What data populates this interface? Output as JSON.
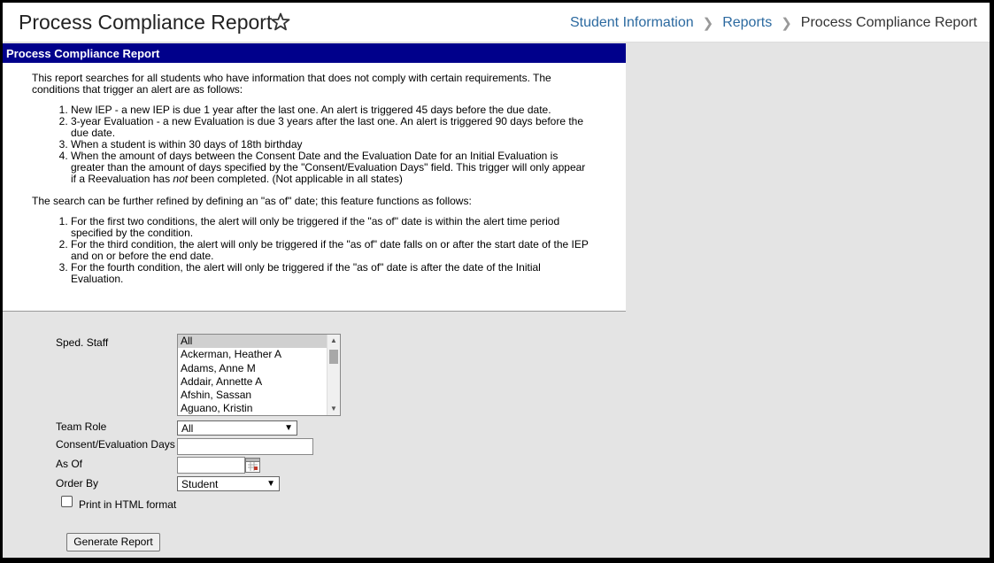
{
  "header": {
    "title": "Process Compliance Report",
    "breadcrumb": [
      "Student Information",
      "Reports",
      "Process Compliance Report"
    ]
  },
  "panel": {
    "title": "Process Compliance Report",
    "intro": "This report searches for all students who have information that does not comply with certain requirements. The conditions that trigger an alert are as follows:",
    "conditions": [
      "New IEP - a new IEP is due 1 year after the last one. An alert is triggered 45 days before the due date.",
      "3-year Evaluation - a new Evaluation is due 3 years after the last one. An alert is triggered 90 days before the due date.",
      "When a student is within 30 days of 18th birthday",
      "When the amount of days between the Consent Date and the Evaluation Date for an Initial Evaluation is greater than the amount of days specified by the \"Consent/Evaluation Days\" field. This trigger will only appear if a Reevaluation has not been completed. (Not applicable in all states)"
    ],
    "refine_intro": "The search can be further refined by defining an \"as of\" date; this feature functions as follows:",
    "refinements": [
      "For the first two conditions, the alert will only be triggered if the \"as of\" date is within the alert time period specified by the condition.",
      "For the third condition, the alert will only be triggered if the \"as of\" date falls on or after the start date of the IEP and on or before the end date.",
      "For the fourth condition, the alert will only be triggered if the \"as of\" date is after the date of the Initial Evaluation."
    ]
  },
  "form": {
    "sped_staff_label": "Sped. Staff",
    "sped_staff_options": [
      "All",
      "Ackerman, Heather A",
      "Adams, Anne M",
      "Addair, Annette A",
      "Afshin, Sassan",
      "Aguano, Kristin"
    ],
    "team_role_label": "Team Role",
    "team_role_value": "All",
    "consent_days_label": "Consent/Evaluation Days",
    "consent_days_value": "",
    "as_of_label": "As Of",
    "as_of_value": "",
    "order_by_label": "Order By",
    "order_by_value": "Student",
    "print_html_label": "Print in HTML format",
    "generate_label": "Generate Report"
  },
  "colors": {
    "panel_header_bg": "#00008b",
    "link": "#2c6aa0",
    "background": "#e4e4e4"
  }
}
